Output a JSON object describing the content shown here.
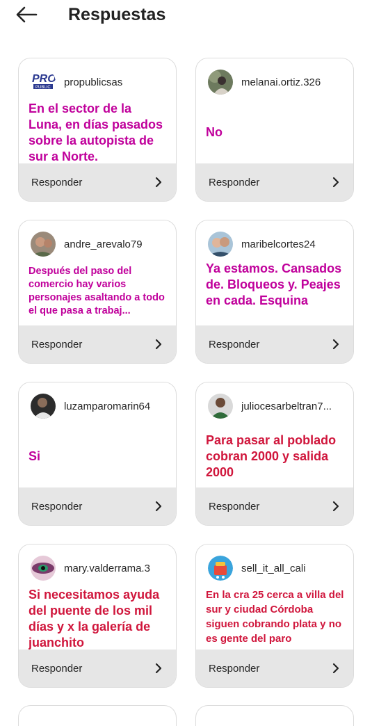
{
  "header": {
    "title": "Respuestas",
    "back_icon": "arrow-left-icon"
  },
  "reply_label": "Responder",
  "cards": [
    {
      "username": "propublicsas",
      "avatar": "propublicsas-logo",
      "text": "En el sector de la Luna, en días pasados sobre la autopista de sur a Norte.",
      "color": "#c0009b"
    },
    {
      "username": "melanai.ortiz.326",
      "avatar": "melanai-photo",
      "text": "No",
      "color": "#c0009b"
    },
    {
      "username": "andre_arevalo79",
      "avatar": "andre-photo",
      "text": "Después del paso del comercio hay varios personajes asaltando a todo el que pasa a trabaj...",
      "color": "#c0009b"
    },
    {
      "username": "maribelcortes24",
      "avatar": "maribel-photo",
      "text": "Ya estamos. Cansados de. Bloqueos y. Peajes en cada. Esquina",
      "color": "#c0009b"
    },
    {
      "username": "luzamparomarin64",
      "avatar": "luzamparo-photo",
      "text": "Si",
      "color": "#c0009b"
    },
    {
      "username": "juliocesarbeltran7...",
      "avatar": "juliocesar-photo",
      "text": "Para pasar al poblado cobran 2000 y salida 2000",
      "color": "#d0163c"
    },
    {
      "username": "mary.valderrama.3",
      "avatar": "mary-photo",
      "text": "Si necesitamos ayuda del puente de los mil días y x la galería de juanchito",
      "color": "#d0163c"
    },
    {
      "username": "sell_it_all_cali",
      "avatar": "sellitall-logo",
      "text": "En la cra 25 cerca a villa del sur y ciudad Córdoba siguen cobrando plata y no es gente del paro",
      "color": "#d0163c"
    }
  ]
}
